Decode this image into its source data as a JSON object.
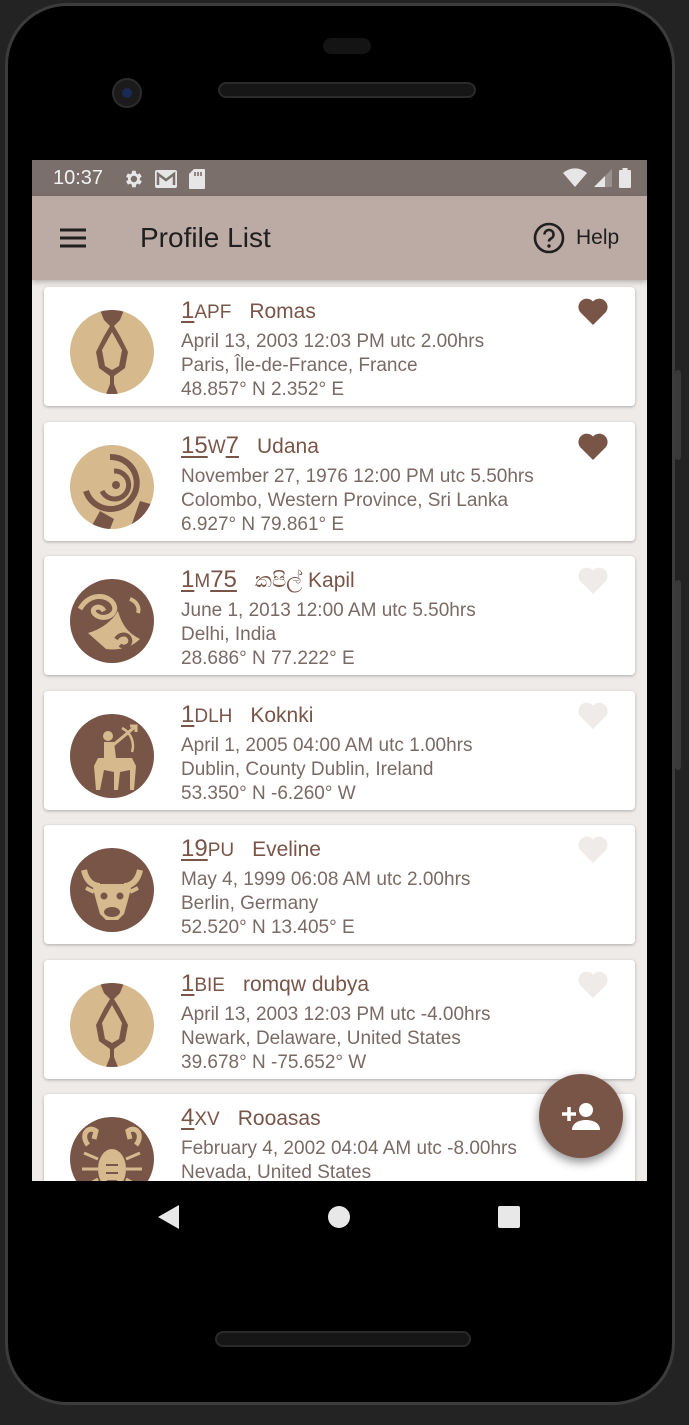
{
  "status_bar": {
    "time": "10:37",
    "icons": [
      "gear-icon",
      "gmail-icon",
      "sd-card-icon",
      "wifi-icon",
      "signal-icon",
      "battery-icon"
    ]
  },
  "app_bar": {
    "title": "Profile List",
    "help_label": "Help",
    "icons": [
      "menu-icon",
      "help-circle-icon"
    ]
  },
  "colors": {
    "primary": "#795548",
    "app_bar": "#bcaaa4",
    "status_bar": "#7b6f6b",
    "background": "#efebe9",
    "avatar_bg": "#795548",
    "avatar_fg": "#d7b98e",
    "heart_inactive": "#efebe9"
  },
  "profiles": [
    {
      "code_big": "1",
      "code_small": "APF",
      "name": "Romas",
      "datetime": "April 13, 2003 12:03 PM utc 2.00hrs",
      "place": "Paris, Île-de-France, France",
      "coords": "48.857° N 2.352° E",
      "favorite": true,
      "sign": "gemini"
    },
    {
      "code_big": "15",
      "code_small": "W",
      "code_big2": "7",
      "name": "Udana",
      "datetime": "November 27, 1976 12:00 PM utc 5.50hrs",
      "place": "Colombo, Western Province, Sri Lanka",
      "coords": "6.927° N 79.861° E",
      "favorite": true,
      "sign": "aries"
    },
    {
      "code_big": "1",
      "code_small": "M",
      "code_big2": "75",
      "name": "කපිල් Kapil",
      "datetime": "June 1, 2013 12:00 AM utc 5.50hrs",
      "place": "Delhi, India",
      "coords": "28.686° N 77.222° E",
      "favorite": false,
      "sign": "capricorn"
    },
    {
      "code_big": "1",
      "code_small": "DLH",
      "name": "Koknki",
      "datetime": "April 1, 2005 04:00 AM utc 1.00hrs",
      "place": "Dublin, County Dublin, Ireland",
      "coords": "53.350° N -6.260° W",
      "favorite": false,
      "sign": "sagittarius"
    },
    {
      "code_big": "19",
      "code_small": "PU",
      "name": "Eveline",
      "datetime": "May 4, 1999 06:08 AM utc 2.00hrs",
      "place": "Berlin, Germany",
      "coords": "52.520° N 13.405° E",
      "favorite": false,
      "sign": "taurus"
    },
    {
      "code_big": "1",
      "code_small": "BIE",
      "name": "romqw dubya",
      "datetime": "April 13, 2003 12:03 PM utc -4.00hrs",
      "place": "Newark, Delaware, United States",
      "coords": "39.678° N -75.652° W",
      "favorite": false,
      "sign": "gemini"
    },
    {
      "code_big": "4",
      "code_small": "XV",
      "name": "Rooasas",
      "datetime": "February 4, 2002 04:04 AM utc -8.00hrs",
      "place": "Nevada, United States",
      "coords": "",
      "favorite": false,
      "sign": "cancer"
    }
  ],
  "fab": {
    "icon": "add-person-icon"
  },
  "nav_bar": {
    "icons": [
      "back-icon",
      "home-icon",
      "recents-icon"
    ]
  }
}
